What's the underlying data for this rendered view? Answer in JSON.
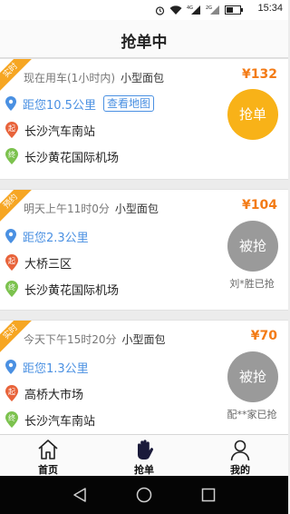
{
  "status_bar": {
    "time": "15:34"
  },
  "header": {
    "title": "抢单中"
  },
  "orders": [
    {
      "tag": "实时",
      "time": "现在用车(1小时内)",
      "vehicle": "小型面包",
      "price": "¥132",
      "distance": "距您10.5公里",
      "map_button": "查看地图",
      "start_badge": "起",
      "start": "长沙汽车南站",
      "end_badge": "终",
      "end": "长沙黄花国际机场",
      "action": "抢单",
      "action_state": "available"
    },
    {
      "tag": "预约",
      "time": "明天上午11时0分",
      "vehicle": "小型面包",
      "price": "¥104",
      "distance": "距您2.3公里",
      "start_badge": "起",
      "start": "大桥三区",
      "end_badge": "终",
      "end": "长沙黄花国际机场",
      "action": "被抢",
      "action_state": "taken",
      "taken_by": "刘*胜已抢"
    },
    {
      "tag": "实时",
      "time": "今天下午15时20分",
      "vehicle": "小型面包",
      "price": "¥70",
      "distance": "距您1.3公里",
      "start_badge": "起",
      "start": "高桥大市场",
      "end_badge": "终",
      "end": "长沙汽车南站",
      "action": "被抢",
      "action_state": "taken",
      "taken_by": "配**家已抢"
    }
  ],
  "tabs": [
    {
      "label": "首页",
      "icon": "home-icon"
    },
    {
      "label": "抢单",
      "icon": "hand-icon"
    },
    {
      "label": "我的",
      "icon": "person-icon"
    }
  ],
  "colors": {
    "accent": "#f8b218",
    "price": "#f37b16",
    "corner_tag": "#f6a623",
    "distance": "#4a90e2",
    "start_badge": "#e8633a",
    "end_badge": "#7cc24e",
    "taken": "#9a9a9a"
  }
}
